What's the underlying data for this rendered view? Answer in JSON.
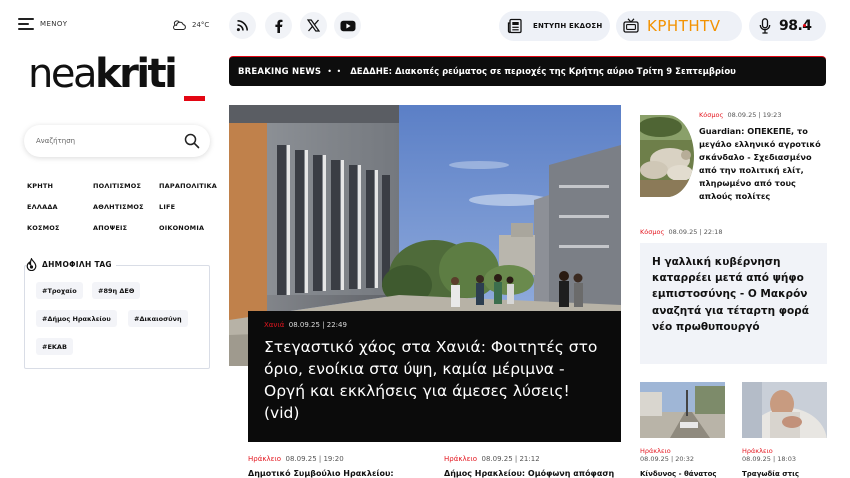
{
  "sidebar": {
    "menu_label": "ΜΕΝΟΥ",
    "weather_temp": "24°C",
    "logo": {
      "light": "nea",
      "bold": "kriti"
    },
    "search_placeholder": "Αναζήτηση",
    "categories": [
      "ΚΡΗΤΗ",
      "ΠΟΛΙΤΙΣΜΟΣ",
      "ΠΑΡΑΠΟΛΙΤΙΚΑ",
      "ΕΛΛΑΔΑ",
      "ΑΘΛΗΤΙΣΜΟΣ",
      "LIFE",
      "ΚΟΣΜΟΣ",
      "ΑΠΟΨΕΙΣ",
      "ΟΙΚΟΝΟΜΙΑ"
    ],
    "popular_title": "ΔΗΜΟΦΙΛΗ TAG",
    "tags": [
      "#Τροχαίο",
      "#89η ΔΕΘ",
      "#Δήμος Ηρακλείου",
      "#Δικαιοσύνη",
      "#ΕΚΑΒ"
    ]
  },
  "topbar": {
    "print_label": "ΕΝΤΥΠΗ ΕΚΔΟΣΗ",
    "tv_label": "ΚΡΗΤΗTV",
    "radio_label": "98.4"
  },
  "breaking": {
    "label": "BREAKING NEWS",
    "headline": "ΔΕΔΔΗΕ: Διακοπές ρεύματος σε περιοχές της Κρήτης αύριο Τρίτη 9 Σεπτεμβρίου"
  },
  "hero": {
    "section": "Χανιά",
    "datetime": "08.09.25 | 22:49",
    "title": "Στεγαστικό χάος στα Χανιά: Φοιτητές στο όριο, ενοίκια στα ύψη, καμία μέριμνα - Οργή και εκκλήσεις για άμεσες λύσεις! (vid)"
  },
  "below_hero": [
    {
      "section": "Ηράκλειο",
      "date": "08.09.25",
      "time": "19:20",
      "title": "Δημοτικό Συμβούλιο Ηρακλείου:"
    },
    {
      "section": "Ηράκλειο",
      "date": "08.09.25",
      "time": "21:12",
      "title": "Δήμος Ηρακλείου: Ομόφωνη απόφαση"
    }
  ],
  "right": {
    "article1": {
      "section": "Κόσμος",
      "date": "08.09.25",
      "time": "19:23",
      "title": "Guardian: ΟΠΕΚΕΠΕ, το μεγάλο ελληνικό αγροτικό σκάνδαλο - Σχεδιασμένο από την πολιτική ελίτ, πληρωμένο από τους απλούς πολίτες"
    },
    "article2": {
      "section": "Κόσμος",
      "date": "08.09.25",
      "time": "22:18",
      "title": "Η γαλλική κυβέρνηση καταρρέει μετά από ψήφο εμπιστοσύνης - Ο Μακρόν αναζητά για τέταρτη φορά νέο πρωθυπουργό"
    },
    "small": [
      {
        "section": "Ηράκλειο",
        "date": "08.09.25",
        "time": "20:32",
        "title": "Κίνδυνος - θάνατος"
      },
      {
        "section": "Ηράκλειο",
        "date": "08.09.25",
        "time": "18:03",
        "title": "Τραγωδία στις"
      }
    ]
  },
  "colors": {
    "accent": "#e30613",
    "tv_orange": "#f39200",
    "breaking_bg": "#0d0d0d",
    "pill_bg": "#eef1f7"
  },
  "icons": [
    "menu-icon",
    "cloud-icon",
    "rss-icon",
    "facebook-icon",
    "x-icon",
    "youtube-icon",
    "newspaper-icon",
    "tv-icon",
    "microphone-icon",
    "search-icon",
    "fire-icon"
  ]
}
